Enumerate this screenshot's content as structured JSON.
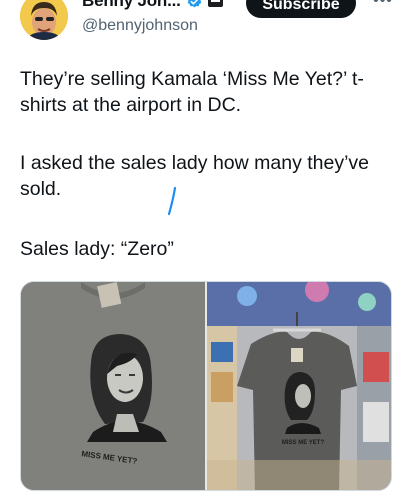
{
  "author": {
    "name": "Benny Joh...",
    "handle": "@bennyjohnson",
    "verified_icon": "verified-badge-icon",
    "affiliation_icon": "affiliation-badge-icon"
  },
  "actions": {
    "subscribe_label": "Subscribe",
    "more_label": "•••"
  },
  "tweet": {
    "paragraph_1": "They’re selling Kamala ‘Miss Me Yet?’ t-shirts at the airport in DC.",
    "paragraph_2": "I asked the sales lady how many they’ve sold.",
    "paragraph_3": "Sales lady: “Zero”"
  },
  "media": {
    "photo_1": {
      "shirt_text": "MISS ME YET?"
    },
    "photo_2": {
      "shirt_text": "MISS ME YET?"
    }
  },
  "colors": {
    "text": "#0f1419",
    "secondary_text": "#536471",
    "verified_blue": "#1d9bf0",
    "button_bg": "#0f1419"
  }
}
